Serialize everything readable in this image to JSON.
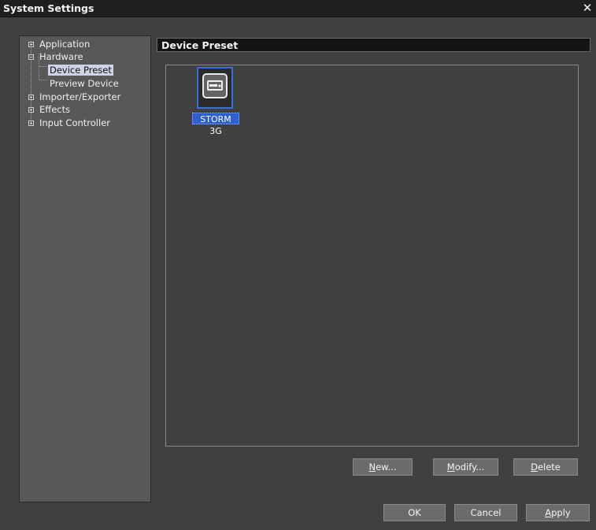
{
  "window": {
    "title": "System Settings",
    "close_glyph": "✕"
  },
  "tree": {
    "items": [
      {
        "label": "Application",
        "expander": "plus"
      },
      {
        "label": "Hardware",
        "expander": "minus"
      },
      {
        "label": "Device Preset",
        "selected": true
      },
      {
        "label": "Preview Device"
      },
      {
        "label": "Importer/Exporter",
        "expander": "plus"
      },
      {
        "label": "Effects",
        "expander": "plus"
      },
      {
        "label": "Input Controller",
        "expander": "plus"
      }
    ]
  },
  "panel": {
    "header": "Device Preset",
    "devices": [
      {
        "label": "STORM 3G",
        "icon": "device-hardware-icon"
      }
    ]
  },
  "panel_buttons": {
    "new": {
      "mnemonic": "N",
      "rest": "ew..."
    },
    "modify": {
      "mnemonic": "M",
      "rest": "odify..."
    },
    "delete": {
      "mnemonic": "D",
      "rest": "elete"
    }
  },
  "dialog_buttons": {
    "ok": "OK",
    "cancel": "Cancel",
    "apply": {
      "mnemonic": "A",
      "rest": "pply"
    }
  },
  "colors": {
    "background": "#404040",
    "tree_bg": "#585858",
    "selection": "#2e5fd1",
    "tree_selection": "#cfd3e8"
  }
}
